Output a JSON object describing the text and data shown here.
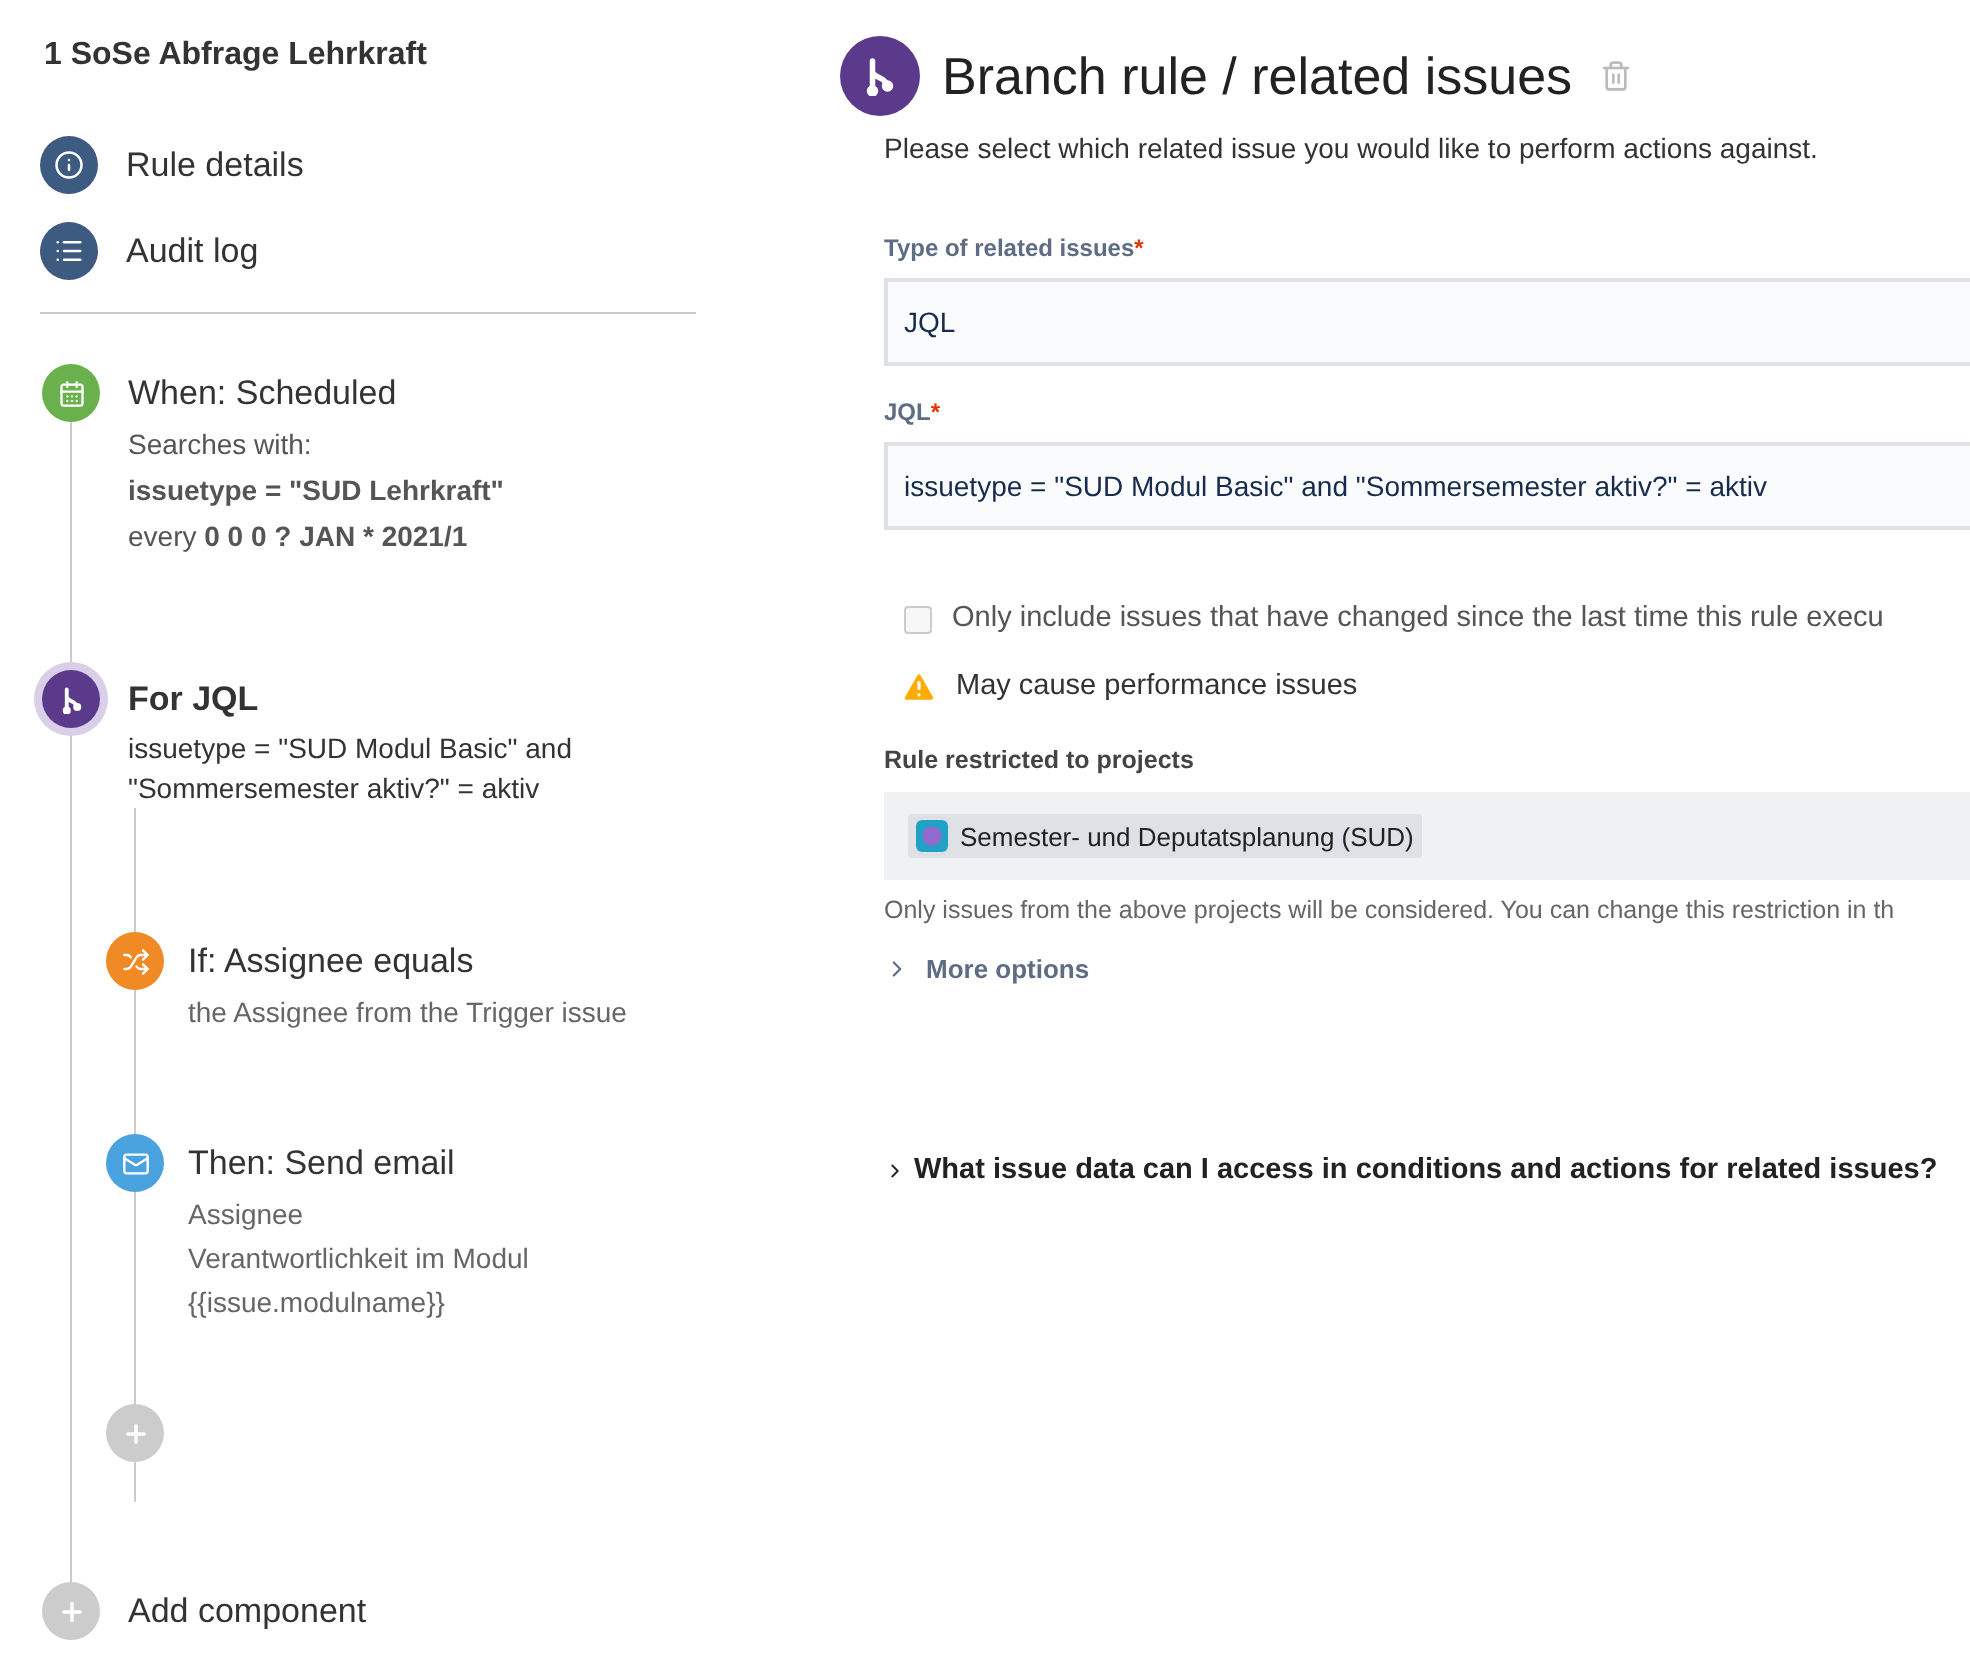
{
  "sidebar": {
    "title": "1 SoSe Abfrage Lehrkraft",
    "nav": [
      {
        "label": "Rule details",
        "kind": "info"
      },
      {
        "label": "Audit log",
        "kind": "audit"
      }
    ],
    "trigger": {
      "title": "When: Scheduled",
      "lines": [
        {
          "text": "Searches with:",
          "bold": false
        },
        {
          "text": "issuetype = \"SUD Lehrkraft\"",
          "bold": true
        },
        {
          "text": "every **0 0 0 ? JAN * 2021/1**",
          "bold": false
        }
      ]
    },
    "branch": {
      "title": "For JQL",
      "description": "issuetype = \"SUD Modul Basic\" and \"Sommersemester aktiv?\" = aktiv",
      "selected": true,
      "children": [
        {
          "kind": "condition",
          "title": "If: Assignee equals",
          "lines": [
            "the Assignee from the Trigger issue"
          ]
        },
        {
          "kind": "action",
          "title": "Then: Send email",
          "lines": [
            "Assignee",
            "Verantwortlichkeit im Modul",
            "{{issue.modulname}}"
          ]
        }
      ]
    },
    "add_component": "Add component"
  },
  "panel": {
    "title": "Branch rule / related issues",
    "intro": "Please select which related issue you would like to perform actions against.",
    "fields": [
      {
        "label": "Type of related issues",
        "required_mark": "*",
        "value": "JQL"
      },
      {
        "label": "JQL",
        "required_mark": "*",
        "value": "issuetype = \"SUD Modul Basic\" and \"Sommersemester aktiv?\" = aktiv"
      }
    ],
    "checkbox": {
      "label": "Only include issues that have changed since the last time this rule execu",
      "checked": false
    },
    "warning": "May cause performance issues",
    "projects_label": "Rule restricted to projects",
    "projects": [
      "Semester- und Deputatsplanung (SUD)"
    ],
    "projects_help": "Only issues from the above projects will be considered. You can change this restriction in th",
    "more_options": {
      "label": "More options",
      "expanded": false
    },
    "faq": {
      "label": "What issue data can I access in conditions and actions for related issues?",
      "expanded": false
    }
  }
}
